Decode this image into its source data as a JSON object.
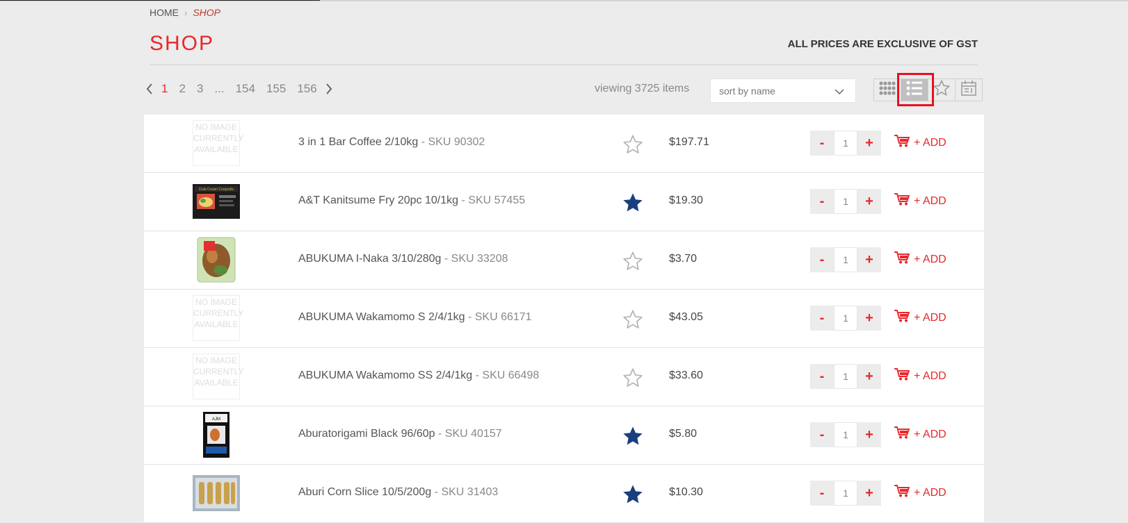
{
  "breadcrumb": {
    "home": "HOME",
    "current": "SHOP"
  },
  "page_title": "SHOP",
  "gst_note": "ALL PRICES ARE EXCLUSIVE OF GST",
  "pagination": {
    "pages": [
      "1",
      "2",
      "3",
      "...",
      "154",
      "155",
      "156"
    ],
    "active": "1"
  },
  "viewing": "viewing 3725 items",
  "sort": {
    "selected": "sort by name"
  },
  "view_modes": [
    {
      "icon": "grid-view-icon",
      "active": false
    },
    {
      "icon": "list-view-icon",
      "active": true
    },
    {
      "icon": "star-view-icon",
      "active": false
    },
    {
      "icon": "calendar-view-icon",
      "active": false
    }
  ],
  "no_image_text": "NO IMAGE CURRENTLY AVAILABLE",
  "add_label": "+ ADD",
  "products": [
    {
      "name": "3 in 1 Bar Coffee 2/10kg",
      "sku": "- SKU 90302",
      "price": "$197.71",
      "favorite": false,
      "qty": "1",
      "image": "none"
    },
    {
      "name": "A&T Kanitsume Fry 20pc 10/1kg",
      "sku": "- SKU 57455",
      "price": "$19.30",
      "favorite": true,
      "qty": "1",
      "image": "box"
    },
    {
      "name": "ABUKUMA I-Naka 3/10/280g",
      "sku": "- SKU 33208",
      "price": "$3.70",
      "favorite": false,
      "qty": "1",
      "image": "bag"
    },
    {
      "name": "ABUKUMA Wakamomo S 2/4/1kg",
      "sku": "- SKU 66171",
      "price": "$43.05",
      "favorite": false,
      "qty": "1",
      "image": "none"
    },
    {
      "name": "ABUKUMA Wakamomo SS 2/4/1kg",
      "sku": "- SKU 66498",
      "price": "$33.60",
      "favorite": false,
      "qty": "1",
      "image": "none"
    },
    {
      "name": "Aburatorigami Black 96/60p",
      "sku": "- SKU 40157",
      "price": "$5.80",
      "favorite": true,
      "qty": "1",
      "image": "pack"
    },
    {
      "name": "Aburi Corn Slice 10/5/200g",
      "sku": "- SKU 31403",
      "price": "$10.30",
      "favorite": true,
      "qty": "1",
      "image": "tray"
    }
  ],
  "colors": {
    "accent": "#e8282b",
    "favorite": "#1a3f7e",
    "highlight": "#e8101e"
  }
}
